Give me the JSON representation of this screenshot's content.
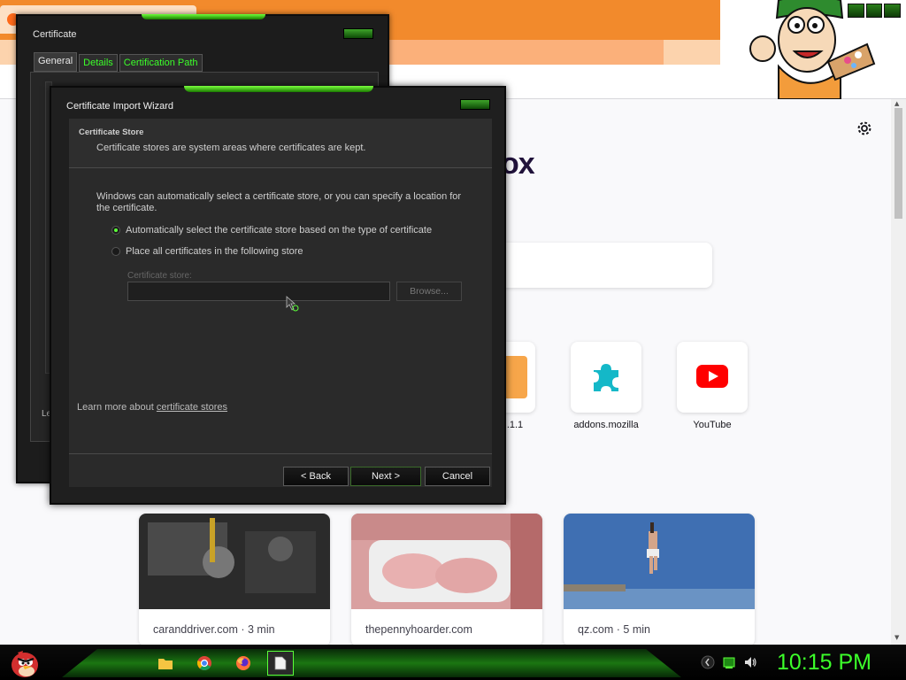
{
  "firefox": {
    "brand_text": "ox",
    "tiles": [
      {
        "label": ".1.1"
      },
      {
        "label": "addons.mozilla"
      },
      {
        "label": "YouTube"
      }
    ],
    "stories": [
      {
        "source": "caranddriver.com · 3 min"
      },
      {
        "source": "thepennyhoarder.com"
      },
      {
        "source": "qz.com · 5 min"
      }
    ]
  },
  "certificate_dialog": {
    "title": "Certificate",
    "tabs": [
      "General",
      "Details",
      "Certification Path"
    ],
    "partial_text": "Le"
  },
  "wizard": {
    "title": "Certificate Import Wizard",
    "header_title": "Certificate Store",
    "header_subtitle": "Certificate stores are system areas where certificates are kept.",
    "description": "Windows can automatically select a certificate store, or you can specify a location for the certificate.",
    "option_auto": "Automatically select the certificate store based on the type of certificate",
    "option_manual": "Place all certificates in the following store",
    "store_label": "Certificate store:",
    "store_value": "",
    "browse_label": "Browse...",
    "learn_prefix": "Learn more about ",
    "learn_link": "certificate stores",
    "back_label": "< Back",
    "next_label": "Next >",
    "cancel_label": "Cancel",
    "selected_option": "auto"
  },
  "taskbar": {
    "clock": "10:15 PM"
  },
  "colors": {
    "accent_green": "#3cff2a",
    "firefox_orange": "#f28a2c"
  }
}
